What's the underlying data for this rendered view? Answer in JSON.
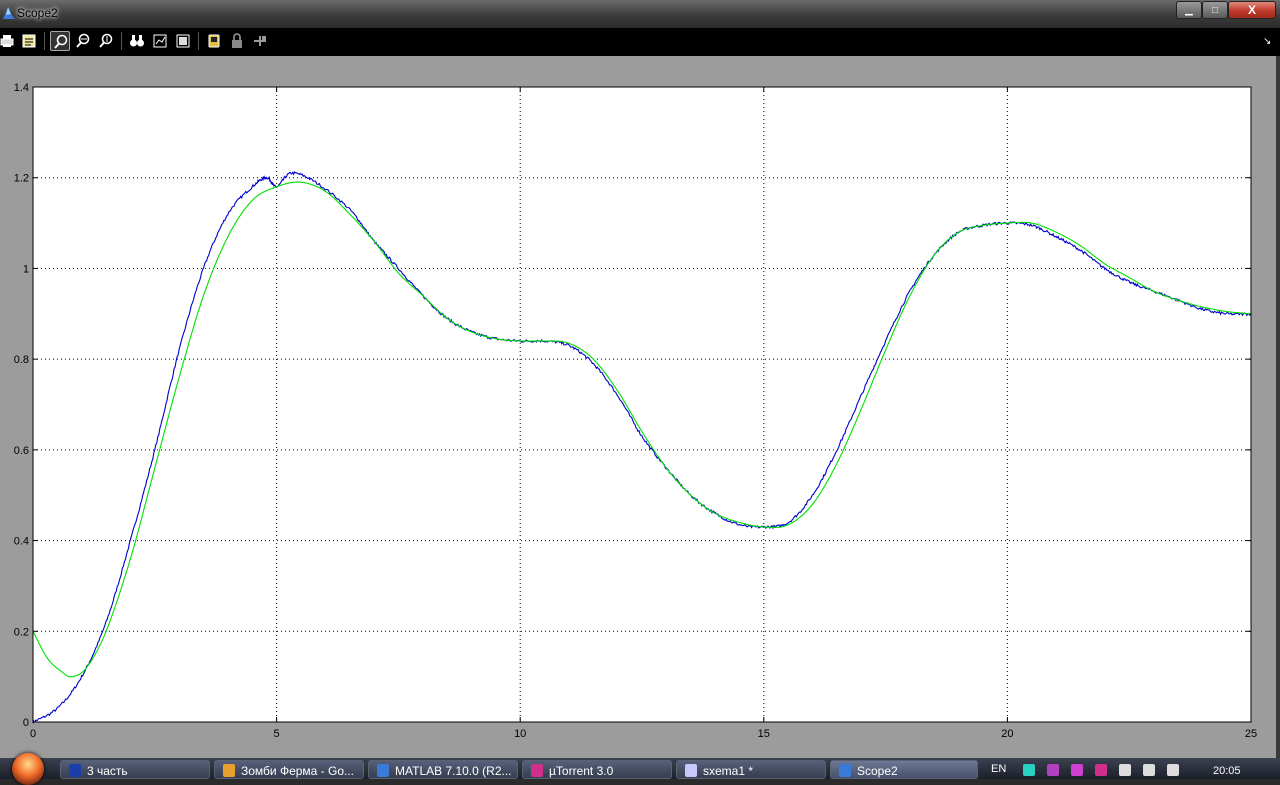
{
  "window": {
    "title": "Scope2",
    "min_glyph": "▁",
    "max_glyph": "□",
    "close_glyph": "X"
  },
  "toolbar": {
    "buttons": [
      {
        "name": "print-icon"
      },
      {
        "name": "parameters-icon"
      },
      {
        "name": "zoom-icon",
        "active": true
      },
      {
        "name": "zoom-x-icon"
      },
      {
        "name": "zoom-y-icon"
      },
      {
        "name": "autoscale-icon"
      },
      {
        "name": "save-axes-icon"
      },
      {
        "name": "restore-axes-icon"
      },
      {
        "name": "floating-scope-icon"
      },
      {
        "name": "lock-icon"
      },
      {
        "name": "signal-selection-icon"
      }
    ],
    "overflow_glyph": "↘"
  },
  "chart_data": {
    "type": "line",
    "xlim": [
      0,
      25
    ],
    "ylim": [
      0,
      1.4
    ],
    "xticks": [
      "0",
      "5",
      "10",
      "15",
      "20",
      "25"
    ],
    "yticks": [
      "0",
      "0.2",
      "0.4",
      "0.6",
      "0.8",
      "1",
      "1.2",
      "1.4"
    ],
    "grid": true,
    "colors": {
      "axes_bg": "#ffffff",
      "figure_bg": "#9c9c9c",
      "grid": "#000000"
    },
    "series": [
      {
        "color": "#0000cc",
        "noise": true,
        "x": [
          0,
          0.5,
          1,
          1.5,
          2,
          2.5,
          3,
          3.5,
          4,
          4.5,
          4.8,
          5,
          5.3,
          5.8,
          6.5,
          7,
          7.5,
          8,
          8.5,
          9,
          9.5,
          10,
          10.5,
          11,
          11.5,
          12,
          12.5,
          13,
          13.5,
          14,
          14.5,
          15,
          15.5,
          16,
          16.5,
          17,
          17.5,
          18,
          18.5,
          19,
          19.5,
          20,
          20.5,
          21,
          21.5,
          22,
          22.5,
          23,
          23.5,
          24,
          24.5,
          25
        ],
        "y": [
          0.0,
          0.03,
          0.1,
          0.22,
          0.4,
          0.6,
          0.82,
          1.0,
          1.12,
          1.18,
          1.2,
          1.18,
          1.21,
          1.19,
          1.13,
          1.06,
          1.0,
          0.94,
          0.89,
          0.86,
          0.845,
          0.84,
          0.84,
          0.83,
          0.79,
          0.72,
          0.63,
          0.56,
          0.5,
          0.46,
          0.435,
          0.43,
          0.44,
          0.5,
          0.6,
          0.72,
          0.84,
          0.95,
          1.03,
          1.08,
          1.095,
          1.1,
          1.095,
          1.07,
          1.04,
          1.0,
          0.97,
          0.95,
          0.93,
          0.91,
          0.9,
          0.9
        ]
      },
      {
        "color": "#00e000",
        "noise": false,
        "x": [
          0,
          0.3,
          0.6,
          0.8,
          1.1,
          1.5,
          2,
          2.5,
          3,
          3.5,
          4,
          4.5,
          5,
          5.5,
          6,
          6.5,
          7,
          7.5,
          8,
          8.5,
          9,
          9.5,
          10,
          10.5,
          11,
          11.5,
          12,
          12.5,
          13,
          13.5,
          14,
          14.5,
          15,
          15.5,
          16,
          16.5,
          17,
          17.5,
          18,
          18.5,
          19,
          19.5,
          20,
          20.5,
          21,
          21.5,
          22,
          22.5,
          23,
          23.5,
          24,
          24.5,
          25
        ],
        "y": [
          0.2,
          0.14,
          0.11,
          0.1,
          0.12,
          0.2,
          0.36,
          0.56,
          0.76,
          0.94,
          1.07,
          1.15,
          1.18,
          1.19,
          1.17,
          1.12,
          1.06,
          0.99,
          0.94,
          0.89,
          0.86,
          0.845,
          0.84,
          0.84,
          0.835,
          0.8,
          0.73,
          0.64,
          0.56,
          0.5,
          0.46,
          0.44,
          0.43,
          0.435,
          0.48,
          0.57,
          0.69,
          0.82,
          0.94,
          1.03,
          1.08,
          1.095,
          1.1,
          1.1,
          1.08,
          1.05,
          1.01,
          0.98,
          0.95,
          0.93,
          0.915,
          0.905,
          0.9
        ]
      }
    ]
  },
  "taskbar": {
    "items": [
      {
        "label": "3 часть",
        "icon_color": "#1a3fa8",
        "active": false
      },
      {
        "label": "Зомби Ферма - Go...",
        "icon_color": "#e8a030",
        "active": false
      },
      {
        "label": "MATLAB  7.10.0 (R2...",
        "icon_color": "#3a7ad8",
        "active": false
      },
      {
        "label": "µTorrent 3.0",
        "icon_color": "#d0308a",
        "active": false
      },
      {
        "label": "sxema1 *",
        "icon_color": "#c8c8ff",
        "active": false
      },
      {
        "label": "Scope2",
        "icon_color": "#3a7ad8",
        "active": true
      }
    ],
    "tray": {
      "language": "EN",
      "clock": "20:05",
      "icons": [
        {
          "name": "network-monitor-icon",
          "color": "#2ad0c0"
        },
        {
          "name": "tool-tray-icon",
          "color": "#b040c0"
        },
        {
          "name": "pen-tray-icon",
          "color": "#d040d0"
        },
        {
          "name": "utorrent-tray-icon",
          "color": "#d0308a"
        },
        {
          "name": "power-tray-icon",
          "color": "#dddddd"
        },
        {
          "name": "signal-tray-icon",
          "color": "#dddddd"
        },
        {
          "name": "volume-tray-icon",
          "color": "#dddddd"
        }
      ]
    }
  }
}
